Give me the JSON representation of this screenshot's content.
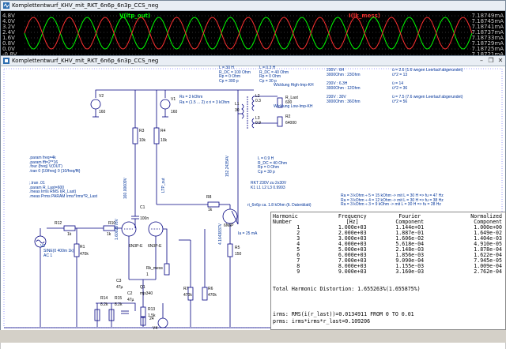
{
  "waveform_window": {
    "title": "Komplettentwurf_KHV_mit_RKT_6n6p_6n3p_CCS_neg",
    "traces": [
      {
        "label": "V(ltp_out)",
        "color": "#00ff00"
      },
      {
        "label": "I(lk_mess)",
        "color": "#ff3030"
      }
    ],
    "left_axis": [
      "4.8V",
      "4.0V",
      "3.2V",
      "2.4V",
      "1.6V",
      "0.8V",
      "0.0V",
      "-0.8V"
    ],
    "right_axis": [
      "7.18749mA",
      "7.18745mA",
      "7.18741mA",
      "7.18737mA",
      "7.18733mA",
      "7.18729mA",
      "7.18725mA",
      "7.18721mA"
    ]
  },
  "schematic_window": {
    "title": "Komplettentwurf_KHV_mit_RKT_6n6p_6n3p_CCS_neg",
    "buttons": {
      "minimize": "–",
      "restore": "❐",
      "close": "✕"
    },
    "directives": [
      ".param freq=4k",
      ".param fft=2**16",
      ".four {freq} V(OUT)",
      ".tran 0 {10/freq} 0 {10/freq/fft}",
      "",
      ";.tran .01",
      ".param R_Last=600",
      ".meas Irms RMS I(R_Last)",
      ".meas Prms PARAM Irms*Irms*R_Last"
    ],
    "transformer_params_1": [
      "L = 30 H",
      "R_DC = 100 Ohm",
      "Rp = 0 Ohm",
      "Cp = 300 p"
    ],
    "transformer_params_2": [
      "L = 0.3 H",
      "R_DC = 40 Ohm",
      "Rp = 0 Ohm",
      "Cp = 30 p"
    ],
    "transformer_params_3": [
      "L = 0.9 H",
      "R_DC = 40 Ohm",
      "Rp = 0 Ohm",
      "Cp = 30 p"
    ],
    "winding_notes": [
      "Wicklung High-Imp-KH",
      "Wicklung Low-Imp-KH"
    ],
    "ra_notes": [
      "Rs = 3 kOhm",
      "Ra = (1.5 ... 2) x ri = 3 kOhm"
    ],
    "voltages_left": [
      "230V : 6H",
      "3000Ohm : 23Ohm",
      "230V : 6.3H",
      "3000Ohm : 12Ohm",
      "230V : 30V",
      "3000Ohm : 36Ohm"
    ],
    "voltages_right": [
      "ü = 2.6 (1.6 wegen Leerlauf abgerundet)",
      "ü^2 = 13",
      "ü = 14",
      "ü^2 = 36",
      "ü = 7.5 (7.6 wegen Leerlauf abgerundet)",
      "ü^2 = 56"
    ],
    "rkt_note": [
      "RKT 230V zu 2x30V",
      "K1 L1 L2 L3 0.9993"
    ],
    "ra_table": [
      "Ra = 3 kOhm ÷ 5 = 15 kOhm  -> mit L = 30 H => fu = 47 Hz",
      "Ra = 3 kOhm ÷ 4 = 12 kOhm  -> mit L = 30 H => fu = 38 Hz",
      "Ra = 3 kOhm ÷ 3 = 9 kOhm   -> mit L = 30 H => fu = 28 Hz"
    ],
    "tube_note": "ri_6n6p ca. 1.8 kOhm (lt. Datenblatt)",
    "ia_note": "Ia = 25 mA",
    "components": {
      "V2": "V2",
      "V2v": "160",
      "V1": "V1",
      "V1v": "160",
      "R3": "R3",
      "R3v": "10k",
      "R4": "R4",
      "R4v": "10k",
      "C1": "C1",
      "C1v": "100n",
      "U1": "6N3P-E",
      "U2": "6N3P-E",
      "U3": "6N6P",
      "R1": "R1",
      "R1v": "470k",
      "R12": "R12",
      "R12v": "1k",
      "R10": "R10",
      "R10v": "1k",
      "R8": "R8",
      "R8v": "1k",
      "R7": "R7",
      "R7v": "470k",
      "R6": "R6",
      "R6v": "470k",
      "R5": "R5",
      "R5v": "150",
      "R14": "R14",
      "R14v": "8.2k",
      "R15": "R15",
      "R15v": "8.2k",
      "R13": "R13",
      "R13v": "1.5k",
      "C2": "C2",
      "C2v": "47µ",
      "C3": "C3",
      "C3v": "47µ",
      "Q1": "Q1",
      "Q1v": "mjs340",
      "V4": "V4",
      "V4v": "24",
      "Rk_mess": "Rk_mess",
      "Rk_messv": "1",
      "L1": "L1",
      "L2": "L2",
      "L3": "L3",
      "L1v": "30",
      "L2v": "0.3",
      "L3v": "0.9",
      "R_Last": "R_Last",
      "R_Lastv": "600",
      "R2": "R2",
      "R2v": "64000",
      "SINE": "SINE(0 400m 1k)",
      "AC": "AC 1",
      "net_ltp": "LTP_out",
      "net_15": "1.6002976V",
      "net_160": "160.00609V",
      "net_4": "4.1643837V",
      "net_152": "152.24354V"
    },
    "fourier": {
      "headers": [
        [
          "Harmonic",
          "Frequency",
          "Fourier",
          "Normalized"
        ],
        [
          "Number",
          "[Hz]",
          "Component",
          "Component"
        ]
      ],
      "rows": [
        [
          "1",
          "1.000e+03",
          "1.144e+01",
          "1.000e+00"
        ],
        [
          "2",
          "2.000e+03",
          "1.887e-01",
          "1.649e-02"
        ],
        [
          "3",
          "3.000e+03",
          "1.606e-02",
          "1.404e-03"
        ],
        [
          "4",
          "4.000e+03",
          "5.618e-04",
          "4.910e-05"
        ],
        [
          "5",
          "5.000e+03",
          "2.148e-03",
          "1.878e-04"
        ],
        [
          "6",
          "6.000e+03",
          "1.856e-03",
          "1.622e-04"
        ],
        [
          "7",
          "7.000e+03",
          "9.090e-04",
          "7.945e-05"
        ],
        [
          "8",
          "8.000e+03",
          "1.155e-03",
          "1.009e-04"
        ],
        [
          "9",
          "9.000e+03",
          "3.160e-03",
          "2.762e-04"
        ]
      ],
      "thd": "Total Harmonic Distortion: 1.655263%(1.655875%)",
      "meas1": "irms: RMS(i(r_last))=0.0134911 FROM 0 TO 0.01",
      "meas2": "prms: irms*irms*r_last=0.109206"
    }
  }
}
